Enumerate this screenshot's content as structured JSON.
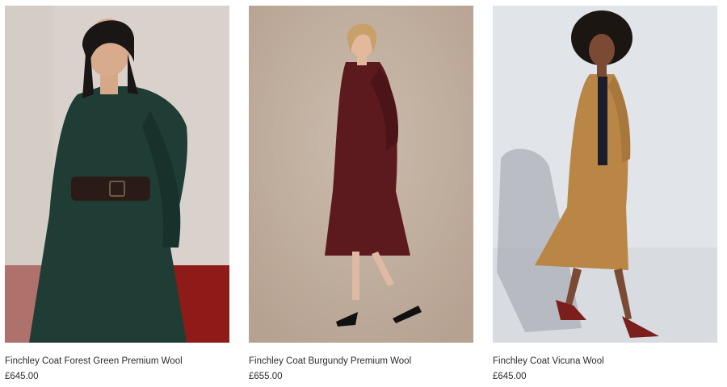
{
  "products": [
    {
      "name": "Finchley Coat Forest Green Premium Wool",
      "price": "£645.00",
      "coat_color": "#1f3d35",
      "background": "#d9d2cc"
    },
    {
      "name": "Finchley Coat Burgundy Premium Wool",
      "price": "£655.00",
      "coat_color": "#5c1a1e",
      "background": "#c4b3a4"
    },
    {
      "name": "Finchley Coat Vicuna Wool",
      "price": "£645.00",
      "coat_color": "#b98645",
      "background": "#e1e4e8"
    }
  ]
}
